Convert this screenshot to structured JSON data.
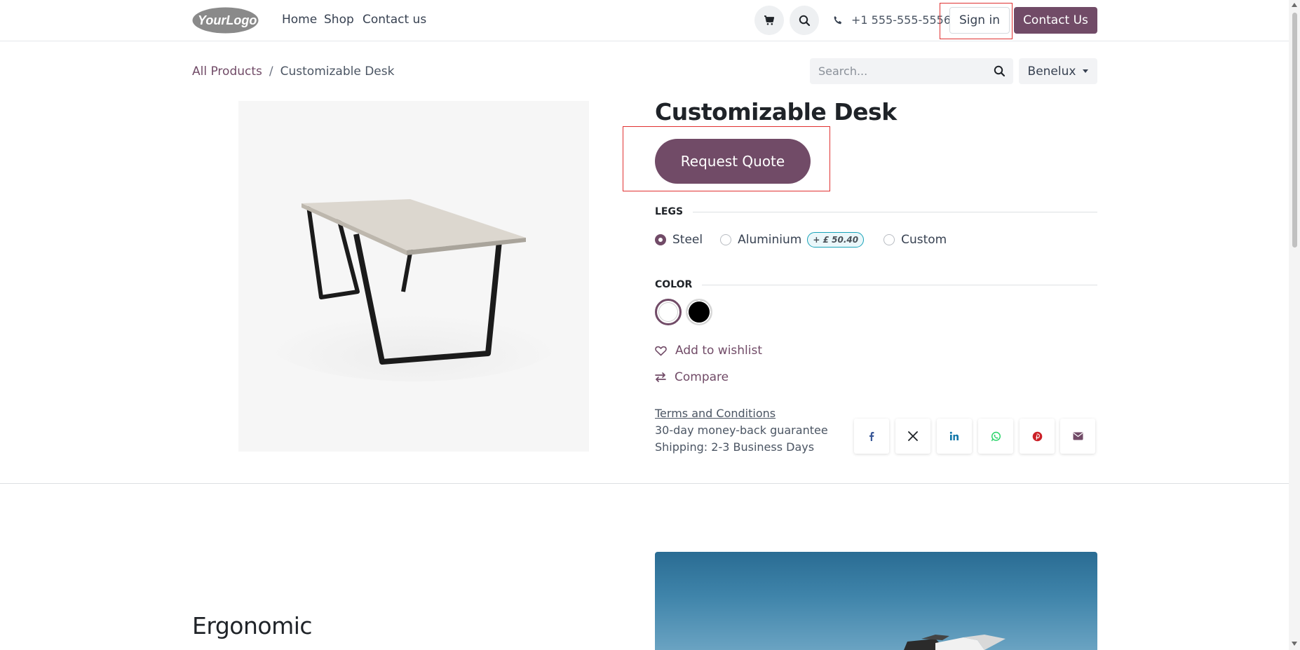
{
  "header": {
    "logo_text": "YourLogo",
    "nav": [
      {
        "label": "Home"
      },
      {
        "label": "Shop"
      },
      {
        "label": "Contact us"
      }
    ],
    "cart_icon": "cart-icon",
    "search_icon": "search-icon",
    "phone": "+1 555-555-5556",
    "sign_in_label": "Sign in",
    "contact_button_label": "Contact Us"
  },
  "breadcrumb": {
    "parent": "All Products",
    "separator": "/",
    "current": "Customizable Desk"
  },
  "search": {
    "placeholder": "Search..."
  },
  "pricelist": {
    "selected": "Benelux"
  },
  "product": {
    "name": "Customizable Desk",
    "quote_button": "Request Quote",
    "attributes": {
      "legs": {
        "label": "LEGS",
        "options": [
          {
            "label": "Steel",
            "selected": true
          },
          {
            "label": "Aluminium",
            "selected": false,
            "extra_price": "+ £ 50.40"
          },
          {
            "label": "Custom",
            "selected": false
          }
        ]
      },
      "color": {
        "label": "COLOR",
        "swatches": [
          {
            "name": "White",
            "hex": "#ffffff",
            "selected": true
          },
          {
            "name": "Black",
            "hex": "#000000",
            "selected": false
          }
        ]
      }
    },
    "wishlist_label": "Add to wishlist",
    "compare_label": "Compare",
    "terms_label": "Terms and Conditions",
    "guarantee": "30-day money-back guarantee",
    "shipping": "Shipping: 2-3 Business Days",
    "share": [
      "facebook-icon",
      "x-icon",
      "linkedin-icon",
      "whatsapp-icon",
      "pinterest-icon",
      "email-icon"
    ]
  },
  "section": {
    "title": "Ergonomic"
  },
  "colors": {
    "brand": "#714b67",
    "highlight_box": "#e03131",
    "badge_border": "#17a2b8"
  }
}
